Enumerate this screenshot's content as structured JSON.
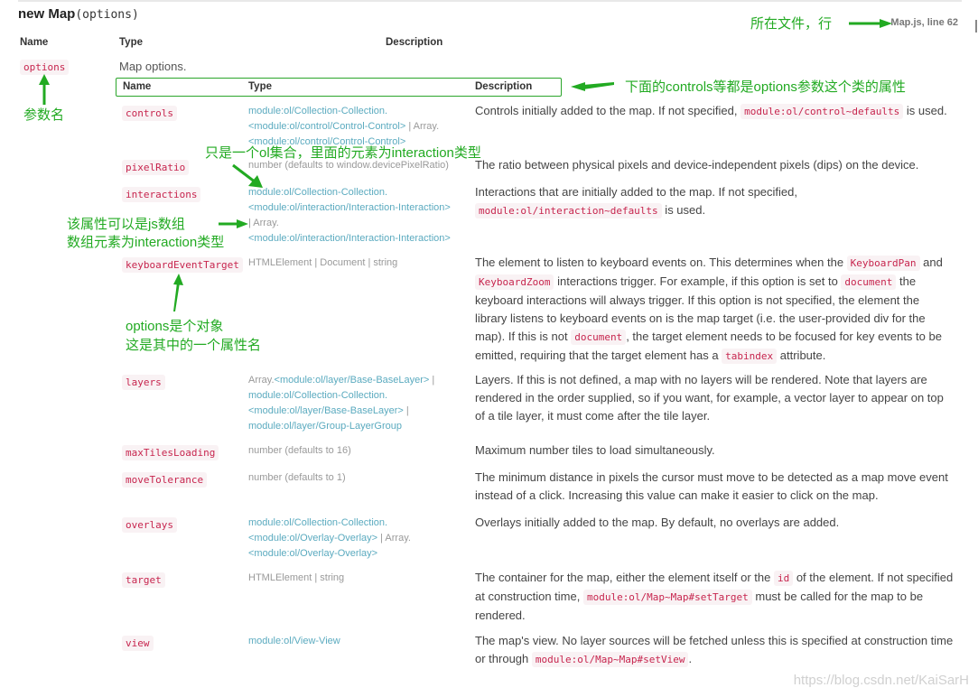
{
  "header": {
    "title_bold": "new Map",
    "title_signature": "(options)",
    "source_link": "Map.js, line 62"
  },
  "outer_table": {
    "columns": [
      "Name",
      "Type",
      "Description"
    ],
    "param_name": "options",
    "param_description": "Map options."
  },
  "inner_table": {
    "columns": [
      "Name",
      "Type",
      "Description"
    ],
    "rows": [
      {
        "name": "controls",
        "type": [
          {
            "text": "module:ol/Collection-Collection.",
            "link": true
          },
          {
            "text": "<module:ol/control/Control-Control>",
            "link": true
          },
          {
            "text": " | Array.",
            "link": false
          },
          {
            "text": "<module:ol/control/Control-Control>",
            "link": true
          }
        ],
        "description": [
          "Controls initially added to the map. If not specified, ",
          {
            "code": "module:ol/control~defaults"
          },
          " is used."
        ]
      },
      {
        "name": "pixelRatio",
        "type": [
          {
            "text": "number (defaults to window.devicePixelRatio)",
            "link": false
          }
        ],
        "description": [
          "The ratio between physical pixels and device-independent pixels (dips) on the device."
        ]
      },
      {
        "name": "interactions",
        "type": [
          {
            "text": "module:ol/Collection-Collection.",
            "link": true
          },
          {
            "text": "<module:ol/interaction/Interaction-Interaction>",
            "link": true
          },
          {
            "text": "| Array.",
            "link": false
          },
          {
            "text": "<module:ol/interaction/Interaction-Interaction>",
            "link": true
          }
        ],
        "description": [
          "Interactions that are initially added to the map. If not specified, ",
          {
            "code": "module:ol/interaction~defaults"
          },
          " is used."
        ]
      },
      {
        "name": "keyboardEventTarget",
        "type": [
          {
            "text": "HTMLElement | Document | string",
            "link": false
          }
        ],
        "description": [
          "The element to listen to keyboard events on. This determines when the ",
          {
            "code": "KeyboardPan"
          },
          " and ",
          {
            "code": "KeyboardZoom"
          },
          " interactions trigger. For example, if this option is set to ",
          {
            "code": "document"
          },
          " the keyboard interactions will always trigger. If this option is not specified, the element the library listens to keyboard events on is the map target (i.e. the user-provided div for the map). If this is not ",
          {
            "code": "document"
          },
          ", the target element needs to be focused for key events to be emitted, requiring that the target element has a ",
          {
            "code": "tabindex"
          },
          " attribute."
        ]
      },
      {
        "name": "layers",
        "type": [
          {
            "text": "Array.",
            "link": false
          },
          {
            "text": "<module:ol/layer/Base-BaseLayer>",
            "link": true
          },
          {
            "text": " | ",
            "link": false
          },
          {
            "text": "module:ol/Collection-Collection.",
            "link": true
          },
          {
            "text": "<module:ol/layer/Base-BaseLayer>",
            "link": true
          },
          {
            "text": " | ",
            "link": false
          },
          {
            "text": "module:ol/layer/Group-LayerGroup",
            "link": true
          }
        ],
        "description": [
          "Layers. If this is not defined, a map with no layers will be rendered. Note that layers are rendered in the order supplied, so if you want, for example, a vector layer to appear on top of a tile layer, it must come after the tile layer."
        ]
      },
      {
        "name": "maxTilesLoading",
        "type": [
          {
            "text": "number (defaults to 16)",
            "link": false
          }
        ],
        "description": [
          "Maximum number tiles to load simultaneously."
        ]
      },
      {
        "name": "moveTolerance",
        "type": [
          {
            "text": "number (defaults to 1)",
            "link": false
          }
        ],
        "description": [
          "The minimum distance in pixels the cursor must move to be detected as a map move event instead of a click. Increasing this value can make it easier to click on the map."
        ]
      },
      {
        "name": "overlays",
        "type": [
          {
            "text": "module:ol/Collection-Collection.",
            "link": true
          },
          {
            "text": "<module:ol/Overlay-Overlay>",
            "link": true
          },
          {
            "text": " | Array.",
            "link": false
          },
          {
            "text": "<module:ol/Overlay-Overlay>",
            "link": true
          }
        ],
        "description": [
          "Overlays initially added to the map. By default, no overlays are added."
        ]
      },
      {
        "name": "target",
        "type": [
          {
            "text": "HTMLElement | string",
            "link": false
          }
        ],
        "description": [
          "The container for the map, either the element itself or the ",
          {
            "code": "id"
          },
          " of the element. If not specified at construction time, ",
          {
            "code": "module:ol/Map~Map#setTarget"
          },
          " must be called for the map to be rendered."
        ]
      },
      {
        "name": "view",
        "type": [
          {
            "text": "module:ol/View-View",
            "link": true
          }
        ],
        "description": [
          "The map's view. No layer sources will be fetched unless this is specified at construction time or through ",
          {
            "code": "module:ol/Map~Map#setView"
          },
          "."
        ]
      }
    ]
  },
  "annotations": {
    "file_line": "所在文件，行",
    "inner_props": "下面的controls等都是options参数这个类的属性",
    "param_name": "参数名",
    "ol_collection": "只是一个ol集合，里面的元素为interaction类型",
    "js_array_line1": "该属性可以是js数组",
    "js_array_line2": "数组元素为interaction类型",
    "options_obj_line1": "options是个对象",
    "options_obj_line2": "这是其中的一个属性名",
    "color": "#22aa22"
  },
  "watermark": "https://blog.csdn.net/KaiSarH"
}
